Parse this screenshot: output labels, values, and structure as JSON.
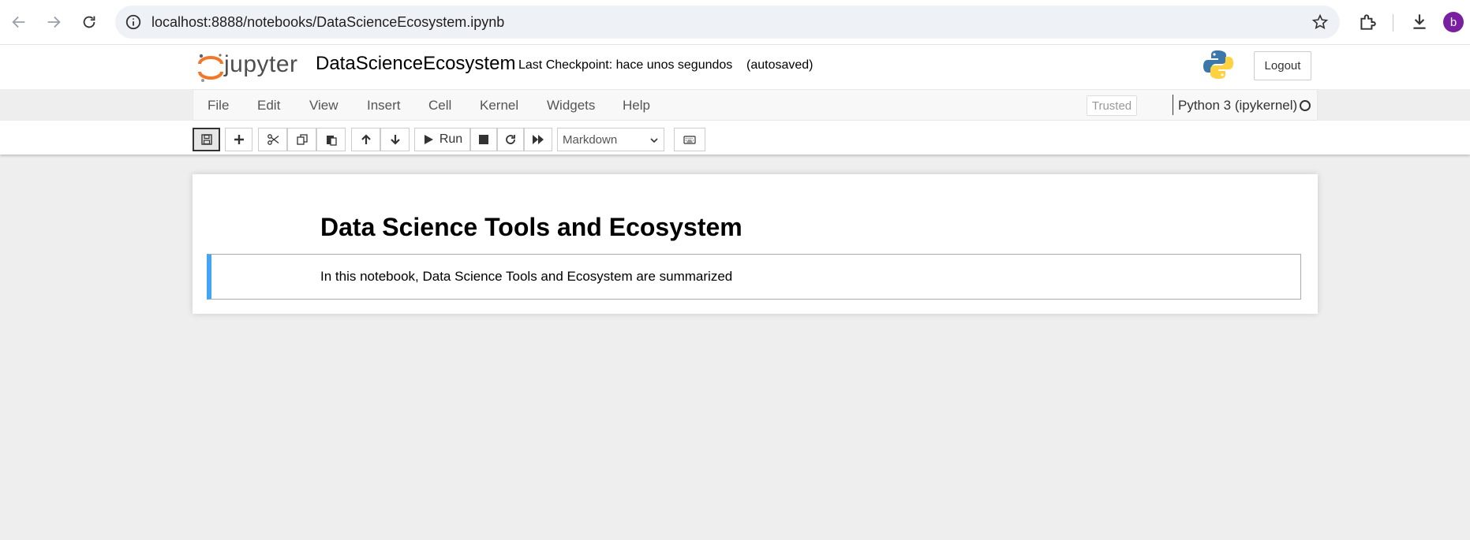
{
  "browser": {
    "url": "localhost:8888/notebooks/DataScienceEcosystem.ipynb",
    "profile_initial": "b"
  },
  "header": {
    "logo_text": "jupyter",
    "notebook_title": "DataScienceEcosystem",
    "checkpoint": "Last Checkpoint: hace unos segundos",
    "autosave": "(autosaved)",
    "logout_label": "Logout"
  },
  "menubar": {
    "items": [
      "File",
      "Edit",
      "View",
      "Insert",
      "Cell",
      "Kernel",
      "Widgets",
      "Help"
    ],
    "trusted_label": "Trusted",
    "kernel_name": "Python 3 (ipykernel)"
  },
  "toolbar": {
    "run_label": "Run",
    "cell_type": "Markdown"
  },
  "notebook": {
    "heading": "Data Science Tools and Ecosystem",
    "markdown_text": "In this notebook, Data Science Tools and Ecosystem are summarized"
  },
  "colors": {
    "accent_selected_cell": "#42a5f5",
    "jupyter_orange": "#f37726",
    "avatar": "#7b1fa2"
  }
}
